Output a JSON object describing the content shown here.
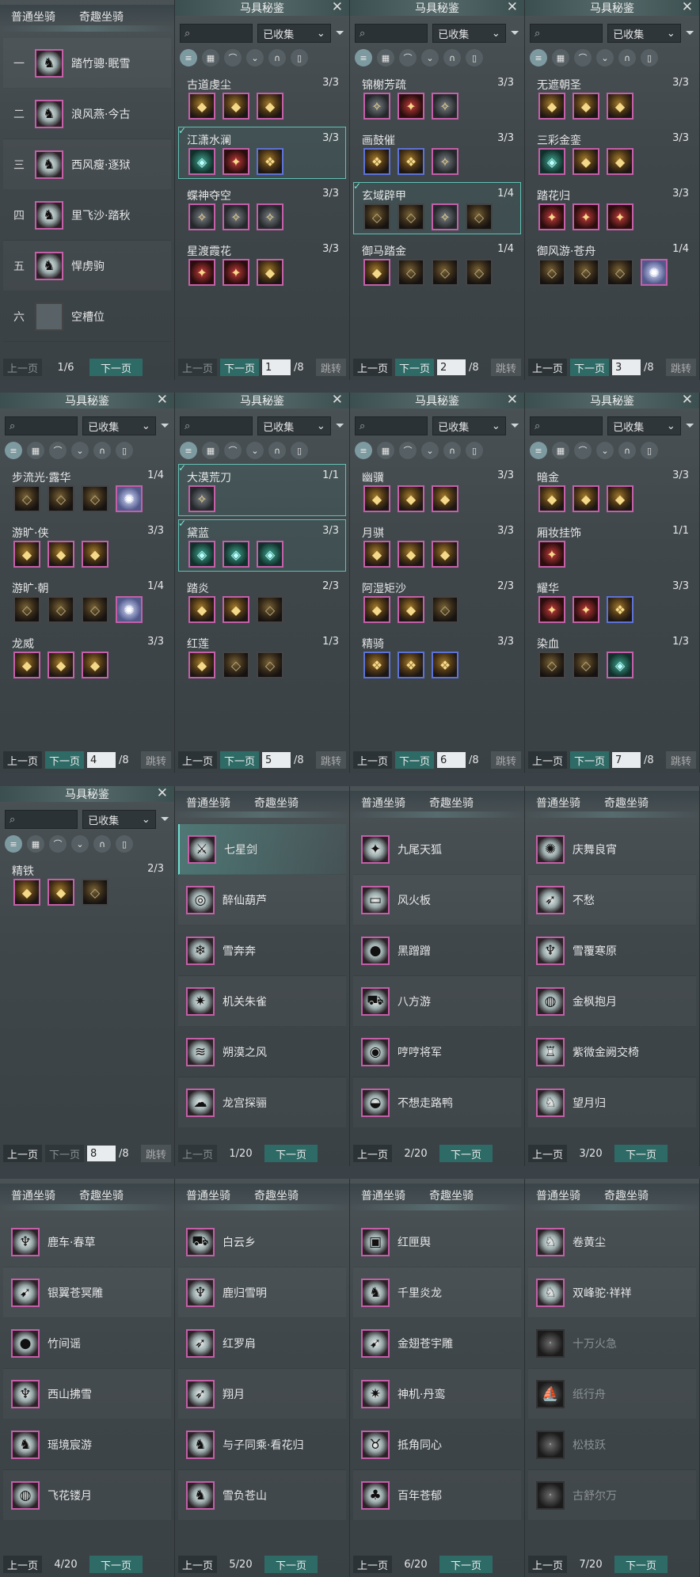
{
  "common": {
    "title": "马具秘鉴",
    "close": "✕",
    "filter": "已收集",
    "prev": "上一页",
    "next": "下一页",
    "jump": "跳转",
    "tab_normal": "普通坐骑",
    "tab_fun": "奇趣坐骑"
  },
  "colors": {
    "accent": "#5fc2b4",
    "rare_border": "#c45fa8",
    "epic_border": "#5d72d6",
    "next_btn": "#2e6b66"
  },
  "mount_list_p1": {
    "rows": [
      {
        "num": "一",
        "name": "踏竹骢·眠雪",
        "icon": "white-horse-icon"
      },
      {
        "num": "二",
        "name": "浪风燕·今古",
        "icon": "white-horse-icon"
      },
      {
        "num": "三",
        "name": "西风瘦·逐狱",
        "icon": "black-horse-icon"
      },
      {
        "num": "四",
        "name": "里飞沙·踏秋",
        "icon": "red-horse-icon"
      },
      {
        "num": "五",
        "name": "悍虏驹",
        "icon": "white-horse-icon"
      },
      {
        "num": "六",
        "name": "空槽位",
        "icon": "empty-slot-icon"
      }
    ],
    "page": "1/6"
  },
  "saddle_pages": [
    {
      "page": "1",
      "total": "/8",
      "sets": [
        {
          "name": "古道虔尘",
          "count": "3/3",
          "slots": [
            "a",
            "a",
            "a"
          ]
        },
        {
          "name": "江潇水澜",
          "count": "3/3",
          "slots": [
            "t",
            "r",
            "b"
          ],
          "selected": true
        },
        {
          "name": "蝶神夺空",
          "count": "3/3",
          "slots": [
            "s",
            "s",
            "s"
          ]
        },
        {
          "name": "星渡霞花",
          "count": "3/3",
          "slots": [
            "r",
            "r",
            "a"
          ]
        }
      ]
    },
    {
      "page": "2",
      "total": "/8",
      "sets": [
        {
          "name": "锦榭芳疏",
          "count": "3/3",
          "slots": [
            "s",
            "r",
            "s"
          ]
        },
        {
          "name": "画鼓催",
          "count": "3/3",
          "slots": [
            "b",
            "b",
            "s"
          ]
        },
        {
          "name": "玄域辟甲",
          "count": "1/4",
          "slots": [
            "g",
            "g",
            "s",
            "g"
          ],
          "selected": true
        },
        {
          "name": "御马踏金",
          "count": "1/4",
          "slots": [
            "a",
            "g",
            "g",
            "g"
          ]
        }
      ]
    },
    {
      "page": "3",
      "total": "/8",
      "sets": [
        {
          "name": "无遮朝圣",
          "count": "3/3",
          "slots": [
            "a",
            "a",
            "a"
          ]
        },
        {
          "name": "三彩金銮",
          "count": "3/3",
          "slots": [
            "t",
            "a",
            "a"
          ]
        },
        {
          "name": "踏花归",
          "count": "3/3",
          "slots": [
            "r",
            "r",
            "r"
          ]
        },
        {
          "name": "御风游·苍舟",
          "count": "1/4",
          "slots": [
            "g",
            "g",
            "g",
            "w"
          ]
        }
      ]
    },
    {
      "page": "4",
      "total": "/8",
      "sets": [
        {
          "name": "步流光·露华",
          "count": "1/4",
          "slots": [
            "g",
            "g",
            "g",
            "w"
          ]
        },
        {
          "name": "游旷·侠",
          "count": "3/3",
          "slots": [
            "a",
            "a",
            "a"
          ]
        },
        {
          "name": "游旷·朝",
          "count": "1/4",
          "slots": [
            "g",
            "g",
            "g",
            "w"
          ]
        },
        {
          "name": "龙威",
          "count": "3/3",
          "slots": [
            "a",
            "a",
            "a"
          ]
        }
      ]
    },
    {
      "page": "5",
      "total": "/8",
      "sets": [
        {
          "name": "大漠荒刀",
          "count": "1/1",
          "slots": [
            "s"
          ],
          "selected": true
        },
        {
          "name": "黛蓝",
          "count": "3/3",
          "slots": [
            "t",
            "t",
            "t"
          ],
          "selected": true
        },
        {
          "name": "踏炎",
          "count": "2/3",
          "slots": [
            "a",
            "a",
            "g"
          ]
        },
        {
          "name": "红莲",
          "count": "1/3",
          "slots": [
            "a",
            "g",
            "g"
          ]
        }
      ]
    },
    {
      "page": "6",
      "total": "/8",
      "sets": [
        {
          "name": "幽骥",
          "count": "3/3",
          "slots": [
            "a",
            "a",
            "a"
          ]
        },
        {
          "name": "月骐",
          "count": "3/3",
          "slots": [
            "a",
            "a",
            "a"
          ]
        },
        {
          "name": "阿湿矩沙",
          "count": "2/3",
          "slots": [
            "a",
            "a",
            "g"
          ]
        },
        {
          "name": "精骑",
          "count": "3/3",
          "slots": [
            "b",
            "b",
            "b"
          ]
        }
      ]
    },
    {
      "page": "7",
      "total": "/8",
      "sets": [
        {
          "name": "暗金",
          "count": "3/3",
          "slots": [
            "a",
            "a",
            "a"
          ]
        },
        {
          "name": "厢妆挂饰",
          "count": "1/1",
          "slots": [
            "r"
          ]
        },
        {
          "name": "耀华",
          "count": "3/3",
          "slots": [
            "r",
            "r",
            "b"
          ]
        },
        {
          "name": "染血",
          "count": "1/3",
          "slots": [
            "g",
            "g",
            "t"
          ]
        }
      ]
    },
    {
      "page": "8",
      "total": "/8",
      "sets": [
        {
          "name": "精铁",
          "count": "2/3",
          "slots": [
            "a",
            "a",
            "g"
          ]
        }
      ]
    }
  ],
  "fun_pages": [
    {
      "page": "1/20",
      "rows": [
        {
          "name": "七星剑",
          "icon": "sword-icon",
          "highlight": true
        },
        {
          "name": "醉仙葫芦",
          "icon": "gourd-icon"
        },
        {
          "name": "雪奔奔",
          "icon": "snow-mount-icon"
        },
        {
          "name": "机关朱雀",
          "icon": "phoenix-icon"
        },
        {
          "name": "朔漠之风",
          "icon": "wind-mount-icon"
        },
        {
          "name": "龙宫探骊",
          "icon": "cloud-icon"
        }
      ]
    },
    {
      "page": "2/20",
      "rows": [
        {
          "name": "九尾天狐",
          "icon": "fox-icon"
        },
        {
          "name": "风火板",
          "icon": "skateboard-icon"
        },
        {
          "name": "黑蹭蹭",
          "icon": "beast-icon"
        },
        {
          "name": "八方游",
          "icon": "cart-icon"
        },
        {
          "name": "哼哼将军",
          "icon": "pig-icon"
        },
        {
          "name": "不想走路鸭",
          "icon": "duck-icon"
        }
      ]
    },
    {
      "page": "3/20",
      "rows": [
        {
          "name": "庆舞良宵",
          "icon": "lion-icon"
        },
        {
          "name": "不愁",
          "icon": "bird-icon"
        },
        {
          "name": "雪覆寒原",
          "icon": "deer-icon"
        },
        {
          "name": "金枫抱月",
          "icon": "orb-icon"
        },
        {
          "name": "紫微金阙交椅",
          "icon": "chair-icon"
        },
        {
          "name": "望月归",
          "icon": "crane-icon"
        }
      ]
    },
    {
      "page": "4/20",
      "rows": [
        {
          "name": "鹿车·春草",
          "icon": "deer-cart-icon"
        },
        {
          "name": "银翼苍冥雕",
          "icon": "eagle-icon"
        },
        {
          "name": "竹间谣",
          "icon": "panda-icon"
        },
        {
          "name": "西山拂雪",
          "icon": "deer-icon"
        },
        {
          "name": "瑶境宸游",
          "icon": "horse-icon"
        },
        {
          "name": "飞花镂月",
          "icon": "orb-icon"
        }
      ]
    },
    {
      "page": "5/20",
      "rows": [
        {
          "name": "白云乡",
          "icon": "cart-icon"
        },
        {
          "name": "鹿归雪明",
          "icon": "deer-icon"
        },
        {
          "name": "红罗肩",
          "icon": "parrot-icon"
        },
        {
          "name": "翔月",
          "icon": "bird-icon"
        },
        {
          "name": "与子同乘·看花归",
          "icon": "horse-icon"
        },
        {
          "name": "雪负苍山",
          "icon": "horse-icon"
        }
      ]
    },
    {
      "page": "6/20",
      "rows": [
        {
          "name": "红匣舆",
          "icon": "chest-icon"
        },
        {
          "name": "千里炎龙",
          "icon": "dragon-icon"
        },
        {
          "name": "金翅苍宇雕",
          "icon": "eagle-icon"
        },
        {
          "name": "神机·丹鸾",
          "icon": "phoenix-icon"
        },
        {
          "name": "抵角同心",
          "icon": "bull-icon"
        },
        {
          "name": "百年苍郁",
          "icon": "tree-icon"
        }
      ]
    },
    {
      "page": "7/20",
      "rows": [
        {
          "name": "卷黄尘",
          "icon": "ostrich-icon"
        },
        {
          "name": "双峰驼·祥祥",
          "icon": "camel-icon"
        },
        {
          "name": "十万火急",
          "icon": "gray-icon",
          "dim": true
        },
        {
          "name": "纸行舟",
          "icon": "boat-icon",
          "dim": true
        },
        {
          "name": "松枝跃",
          "icon": "gray-icon",
          "dim": true
        },
        {
          "name": "古舒尔万",
          "icon": "gray-icon",
          "dim": true
        }
      ]
    }
  ]
}
